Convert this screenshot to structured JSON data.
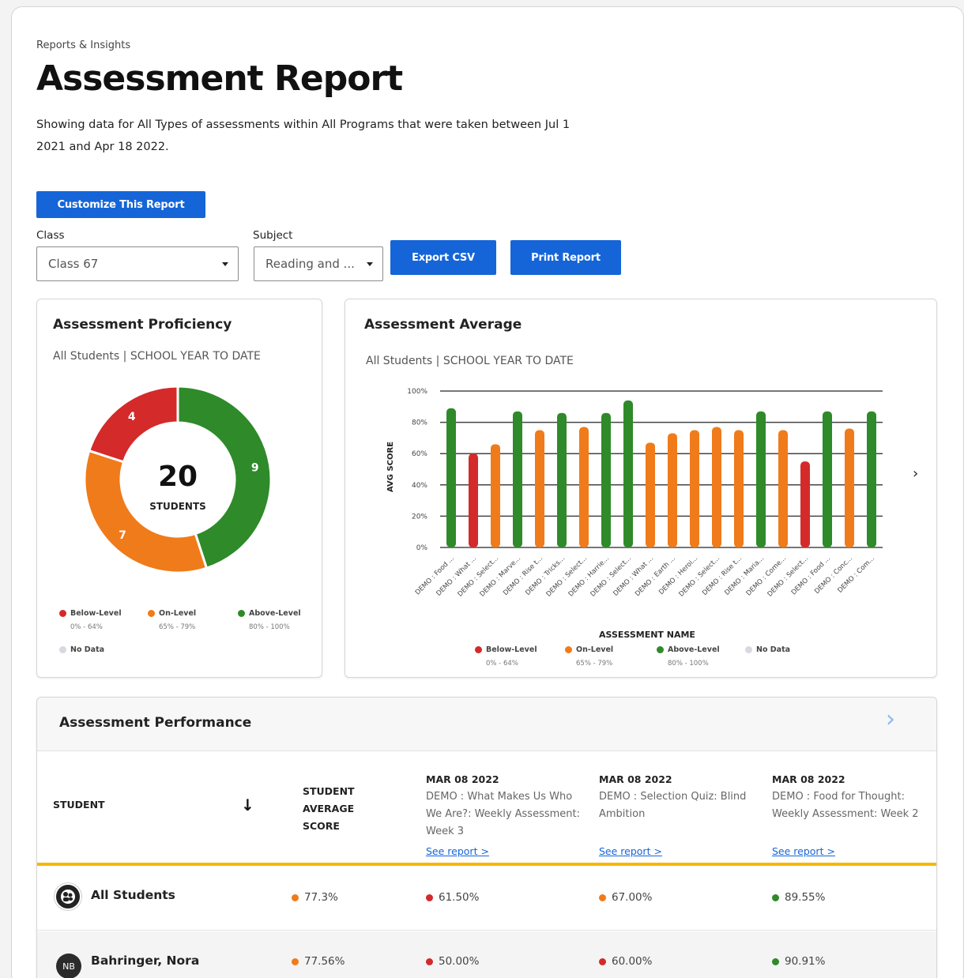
{
  "header": {
    "breadcrumb": "Reports & Insights",
    "title": "Assessment Report",
    "description": "Showing data for All Types of assessments within All Programs that were taken between Jul 1 2021 and Apr 18 2022."
  },
  "buttons": {
    "customize": "Customize This Report",
    "export_csv": "Export CSV",
    "print_report": "Print Report"
  },
  "filters": {
    "class_label": "Class",
    "class_value": "Class 67",
    "subject_label": "Subject",
    "subject_value": "Reading and ..."
  },
  "colors": {
    "below": "#d42a2a",
    "on": "#f07b1a",
    "above": "#2f8a2a",
    "nodata": "#d8d8e2",
    "accent": "#1565d8"
  },
  "proficiency": {
    "title": "Assessment Proficiency",
    "subtitle": "All Students | SCHOOL YEAR TO DATE",
    "total": "20",
    "total_label": "STUDENTS",
    "legend": [
      {
        "name": "Below-Level",
        "range": "0% - 64%"
      },
      {
        "name": "On-Level",
        "range": "65% - 79%"
      },
      {
        "name": "Above-Level",
        "range": "80% - 100%"
      },
      {
        "name": "No Data",
        "range": ""
      }
    ]
  },
  "average": {
    "title": "Assessment Average",
    "subtitle": "All Students | SCHOOL YEAR TO DATE",
    "legend": [
      {
        "name": "Below-Level",
        "range": "0% - 64%"
      },
      {
        "name": "On-Level",
        "range": "65% - 79%"
      },
      {
        "name": "Above-Level",
        "range": "80% - 100%"
      },
      {
        "name": "No Data",
        "range": ""
      }
    ]
  },
  "chart_data": [
    {
      "type": "pie",
      "categories": [
        "Above-Level",
        "On-Level",
        "Below-Level"
      ],
      "values": [
        9,
        7,
        4
      ],
      "center_value": "20",
      "center_label": "STUDENTS"
    },
    {
      "type": "bar",
      "ylabel": "AVG SCORE",
      "xlabel": "ASSESSMENT NAME",
      "ylim": [
        0,
        100
      ],
      "yticks": [
        "0%",
        "20%",
        "40%",
        "60%",
        "80%",
        "100%"
      ],
      "grid": true,
      "categories": [
        "DEMO : Food ...",
        "DEMO : What ...",
        "DEMO : Select...",
        "DEMO : Marve...",
        "DEMO : Rise t...",
        "DEMO : Tricks...",
        "DEMO : Select...",
        "DEMO : Harrie...",
        "DEMO : Select...",
        "DEMO : What ...",
        "DEMO : Earth ...",
        "DEMO : Heroi...",
        "DEMO : Select...",
        "DEMO : Rise t...",
        "DEMO : Maria...",
        "DEMO : Come...",
        "DEMO : Select...",
        "DEMO : Food ...",
        "DEMO : Conc...",
        "DEMO : Com..."
      ],
      "values": [
        89,
        60,
        66,
        87,
        75,
        86,
        77,
        86,
        94,
        67,
        73,
        75,
        77,
        75,
        87,
        75,
        55,
        87,
        76,
        87
      ],
      "levels": [
        "above",
        "below",
        "on",
        "above",
        "on",
        "above",
        "on",
        "above",
        "above",
        "on",
        "on",
        "on",
        "on",
        "on",
        "above",
        "on",
        "below",
        "above",
        "on",
        "above"
      ]
    }
  ],
  "performance": {
    "title": "Assessment Performance",
    "col_student": "STUDENT",
    "col_avg_line1": "STUDENT",
    "col_avg_line2": "AVERAGE",
    "col_avg_line3": "SCORE",
    "columns": [
      {
        "date": "MAR 08 2022",
        "name": "DEMO : What Makes Us Who We Are?: Weekly Assessment: Week 3",
        "link": "See report >"
      },
      {
        "date": "MAR 08 2022",
        "name": "DEMO : Selection Quiz: Blind Ambition",
        "link": "See report >"
      },
      {
        "date": "MAR 08 2022",
        "name": "DEMO : Food for Thought: Weekly Assessment: Week 2",
        "link": "See report >"
      }
    ],
    "rows": [
      {
        "name": "All Students",
        "avatar": "",
        "avg": "77.3%",
        "scores": [
          "61.50%",
          "67.00%",
          "89.55%"
        ]
      },
      {
        "name": "Bahringer, Nora",
        "avatar": "NB",
        "avg": "77.56%",
        "scores": [
          "50.00%",
          "60.00%",
          "90.91%"
        ]
      }
    ]
  }
}
